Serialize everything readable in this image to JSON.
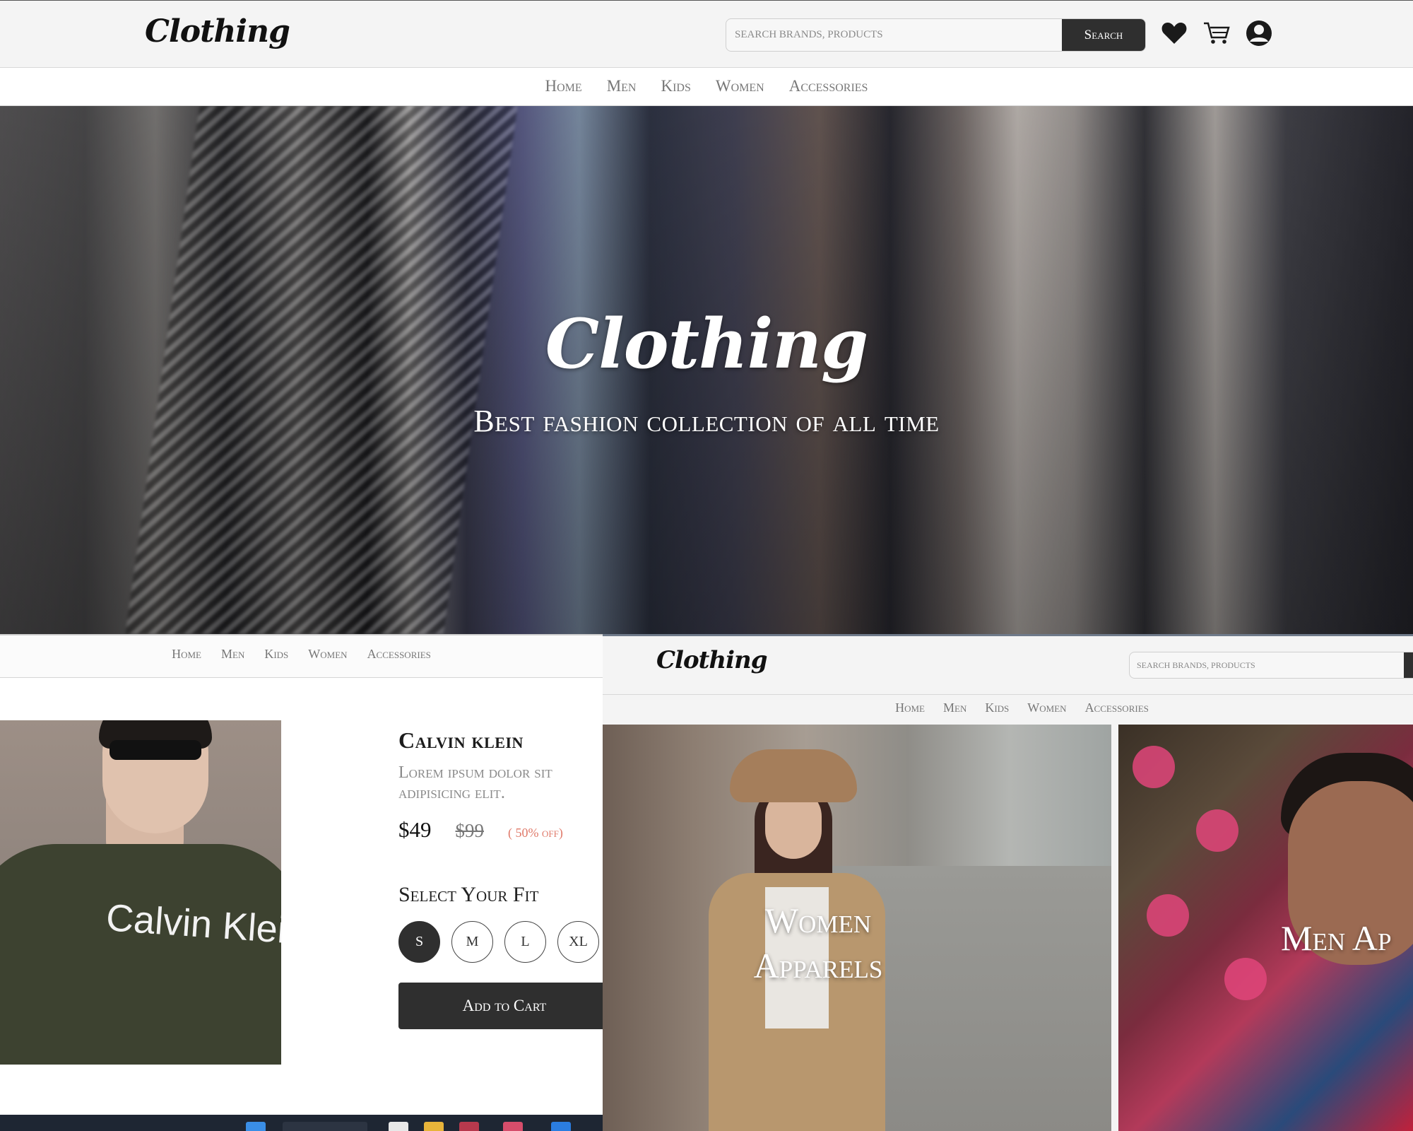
{
  "header": {
    "logo": "Clothing",
    "search_placeholder": "SEARCH BRANDS, PRODUCTS",
    "search_button": "Search",
    "icons": [
      "heart-icon",
      "cart-icon",
      "user-icon"
    ]
  },
  "nav": {
    "items": [
      "Home",
      "Men",
      "Kids",
      "Women",
      "Accessories"
    ]
  },
  "hero": {
    "logo": "Clothing",
    "tagline": "Best fashion collection of all time"
  },
  "product": {
    "nav_items": [
      "Home",
      "Men",
      "Kids",
      "Women",
      "Accessories"
    ],
    "brand_print": "Calvin Klein",
    "title": "Calvin klein",
    "description_line1": "Lorem ipsum dolor sit",
    "description_line2": "adipisicing elit.",
    "price": "$49",
    "old_price": "$99",
    "discount": "( 50% off)",
    "fit_label": "Select Your Fit",
    "sizes": [
      "S",
      "M",
      "L",
      "XL"
    ],
    "selected_size": "S",
    "add_to_cart": "Add to Cart"
  },
  "categories": {
    "logo": "Clothing",
    "search_placeholder": "SEARCH BRANDS, PRODUCTS",
    "nav_items": [
      "Home",
      "Men",
      "Kids",
      "Women",
      "Accessories"
    ],
    "women_title": "Women Apparels",
    "men_title": "Men Ap"
  },
  "colors": {
    "dark": "#2f2f2f",
    "header_bg": "#f4f4f4",
    "nav_text": "#777777",
    "discount": "#e07a6a"
  }
}
